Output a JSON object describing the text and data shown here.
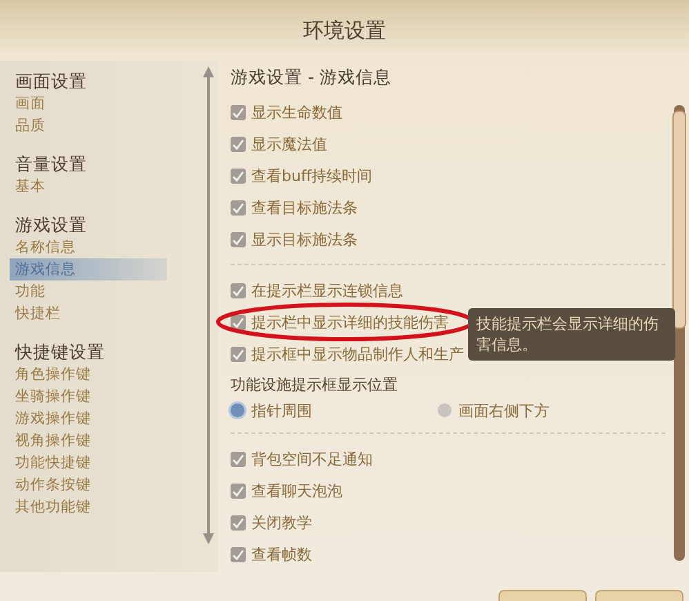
{
  "window": {
    "title": "环境设置"
  },
  "sidebar": [
    {
      "title": "画面设置",
      "items": [
        {
          "label": "画面",
          "selected": false
        },
        {
          "label": "品质",
          "selected": false
        }
      ]
    },
    {
      "title": "音量设置",
      "items": [
        {
          "label": "基本",
          "selected": false
        }
      ]
    },
    {
      "title": "游戏设置",
      "items": [
        {
          "label": "名称信息",
          "selected": false
        },
        {
          "label": "游戏信息",
          "selected": true
        },
        {
          "label": "功能",
          "selected": false
        },
        {
          "label": "快捷栏",
          "selected": false
        }
      ]
    },
    {
      "title": "快捷键设置",
      "items": [
        {
          "label": "角色操作键",
          "selected": false
        },
        {
          "label": "坐骑操作键",
          "selected": false
        },
        {
          "label": "游戏操作键",
          "selected": false
        },
        {
          "label": "视角操作键",
          "selected": false
        },
        {
          "label": "功能快捷键",
          "selected": false
        },
        {
          "label": "动作条按键",
          "selected": false
        },
        {
          "label": "其他功能键",
          "selected": false
        }
      ]
    }
  ],
  "section_title": "游戏设置 - 游戏信息",
  "options": [
    {
      "kind": "checkbox",
      "label": "显示生命数值",
      "checked": true
    },
    {
      "kind": "checkbox",
      "label": "显示魔法值",
      "checked": true
    },
    {
      "kind": "checkbox",
      "label": "查看buff持续时间",
      "checked": true
    },
    {
      "kind": "checkbox",
      "label": "查看目标施法条",
      "checked": true
    },
    {
      "kind": "checkbox",
      "label": "显示目标施法条",
      "checked": true
    },
    {
      "kind": "divider"
    },
    {
      "kind": "checkbox",
      "label": "在提示栏显示连锁信息",
      "checked": true
    },
    {
      "kind": "checkbox",
      "label": "提示栏中显示详细的技能伤害",
      "checked": true,
      "circled": true,
      "tooltip": "技能提示栏会显示详细的伤害信息。"
    },
    {
      "kind": "checkbox",
      "label": "提示框中显示物品制作人和生产",
      "checked": true
    },
    {
      "kind": "heading",
      "label": "功能设施提示框显示位置"
    },
    {
      "kind": "radio",
      "choices": [
        {
          "label": "指针周围",
          "selected": true
        },
        {
          "label": "画面右侧下方",
          "selected": false
        }
      ]
    },
    {
      "kind": "divider"
    },
    {
      "kind": "checkbox",
      "label": "背包空间不足通知",
      "checked": true
    },
    {
      "kind": "checkbox",
      "label": "查看聊天泡泡",
      "checked": true
    },
    {
      "kind": "checkbox",
      "label": "关闭教学",
      "checked": true
    },
    {
      "kind": "checkbox",
      "label": "查看帧数",
      "checked": true
    }
  ]
}
